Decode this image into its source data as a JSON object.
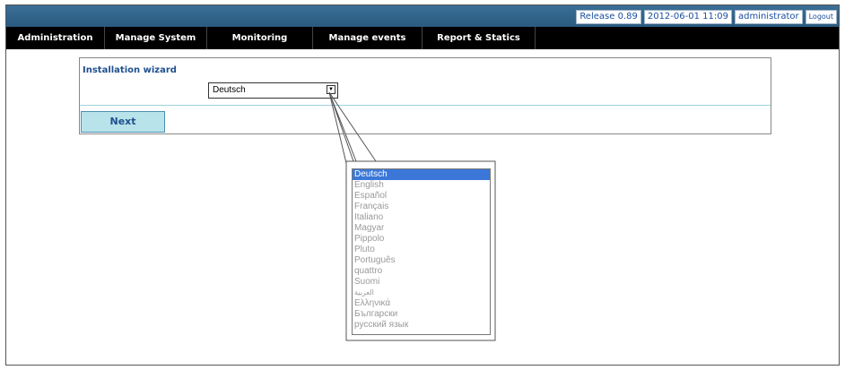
{
  "header": {
    "release": "Release 0.89",
    "datetime": "2012-06-01 11:09",
    "user": "administrator",
    "logout": "Logout"
  },
  "menu": {
    "items": [
      {
        "label": "Administration"
      },
      {
        "label": "Manage System"
      },
      {
        "label": "Monitoring"
      },
      {
        "label": "Manage events"
      },
      {
        "label": "Report & Statics"
      }
    ]
  },
  "wizard": {
    "title": "Installation wizard",
    "language_selected": "Deutsch",
    "next_label": "Next"
  },
  "dropdown": {
    "options": [
      "Deutsch",
      "English",
      "Español",
      "Français",
      "Italiano",
      "Magyar",
      "Pippolo",
      "Pluto",
      "Português",
      "quattro",
      "Suomi",
      "العربية",
      "Ελληνικά",
      "Български",
      "русский язык"
    ],
    "selected_index": 0
  },
  "colors": {
    "accent": "#1f4f8f",
    "selected_option": "#3a77d8",
    "next_button_bg": "#b9e3ea"
  }
}
